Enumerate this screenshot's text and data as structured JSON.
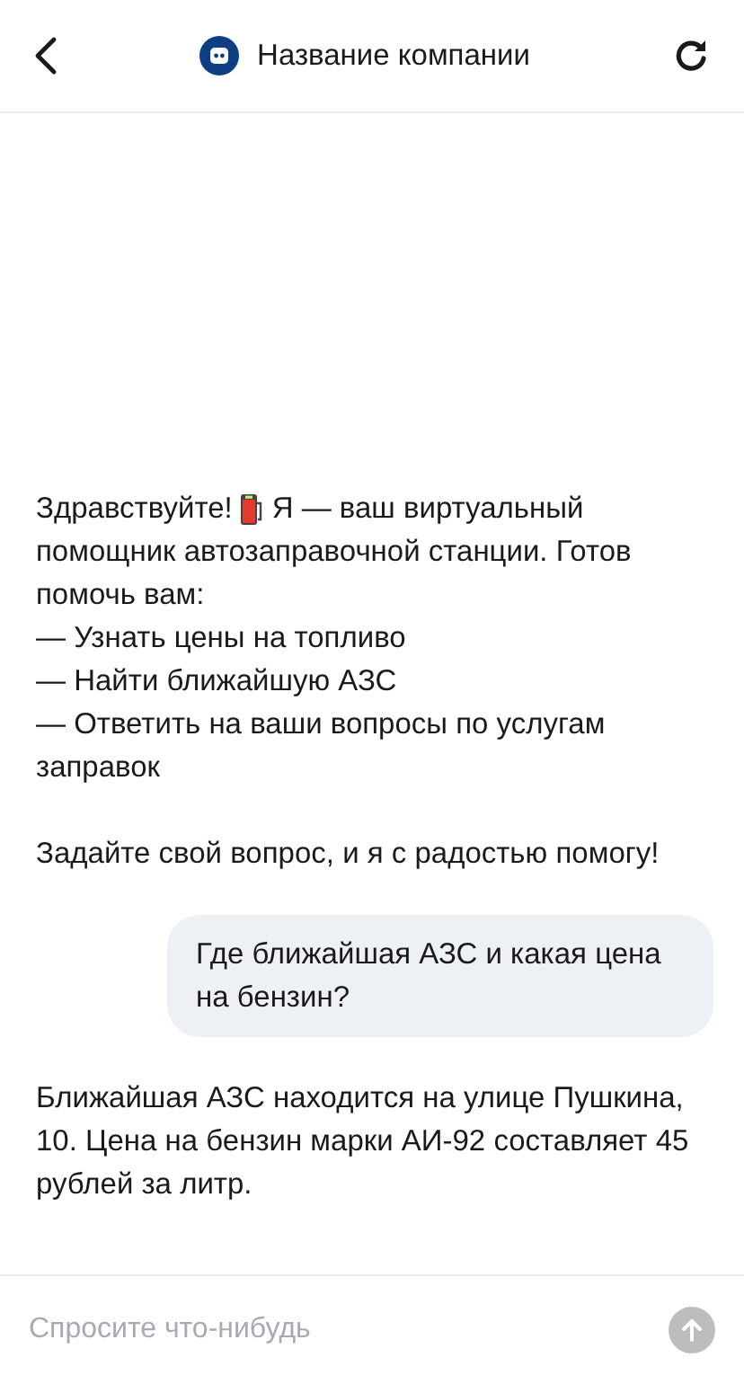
{
  "header": {
    "title": "Название компании"
  },
  "messages": [
    {
      "kind": "bot",
      "intro": {
        "before": "Здравствуйте!",
        "after": "Я — ваш виртуальный"
      },
      "lines": [
        "помощник автозаправочной станции. Готов",
        "помочь вам:",
        "— Узнать цены на топливо",
        "— Найти ближайшую АЗС",
        "— Ответить на ваши вопросы по услугам",
        "заправок"
      ],
      "closing": "Задайте свой вопрос, и я с радостью помогу!"
    },
    {
      "kind": "user",
      "text": "Где ближайшая АЗС и какая цена на бензин?"
    },
    {
      "kind": "bot",
      "lines": [
        "Ближайшая АЗС находится на улице Пушкина, 10. Цена на бензин марки АИ-92 составляет 45 рублей за литр."
      ]
    }
  ],
  "composer": {
    "placeholder": "Спросите что-нибудь",
    "send_disabled": true
  }
}
